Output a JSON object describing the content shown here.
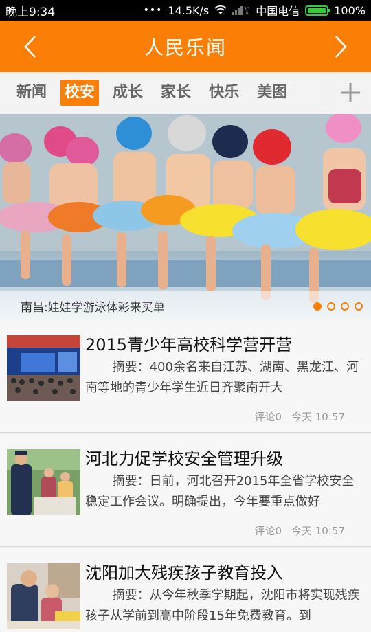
{
  "status": {
    "time": "晚上9:34",
    "speed": "14.5K/s",
    "carrier": "中国电信",
    "battery": "100%"
  },
  "header": {
    "title": "人民乐闻"
  },
  "tabs": [
    {
      "label": "新闻"
    },
    {
      "label": "校安"
    },
    {
      "label": "成长"
    },
    {
      "label": "家长"
    },
    {
      "label": "快乐"
    },
    {
      "label": "美图"
    }
  ],
  "active_tab": "校安",
  "banner": {
    "caption": "南昌:娃娃学游泳体彩来买单",
    "pages": 4,
    "current_page": 1
  },
  "articles": [
    {
      "title": "2015青少年高校科学营开营",
      "summary": "摘要：400余名来自江苏、湖南、黑龙江、河南等地的青少年学生近日齐聚南开大",
      "comments": "评论0",
      "time": "今天 10:57"
    },
    {
      "title": "河北力促学校安全管理升级",
      "summary": "摘要：日前，河北召开2015年全省学校安全稳定工作会议。明确提出，今年要重点做好",
      "comments": "评论0",
      "time": "今天 10:57"
    },
    {
      "title": "沈阳加大残疾孩子教育投入",
      "summary": "摘要：从今年秋季学期起，沈阳市将实现残疾孩子从学前到高中阶段15年免费教育。到",
      "comments": "",
      "time": ""
    }
  ],
  "colors": {
    "accent": "#fb7e07",
    "statusbar": "#000000",
    "battery": "#33cc33"
  }
}
